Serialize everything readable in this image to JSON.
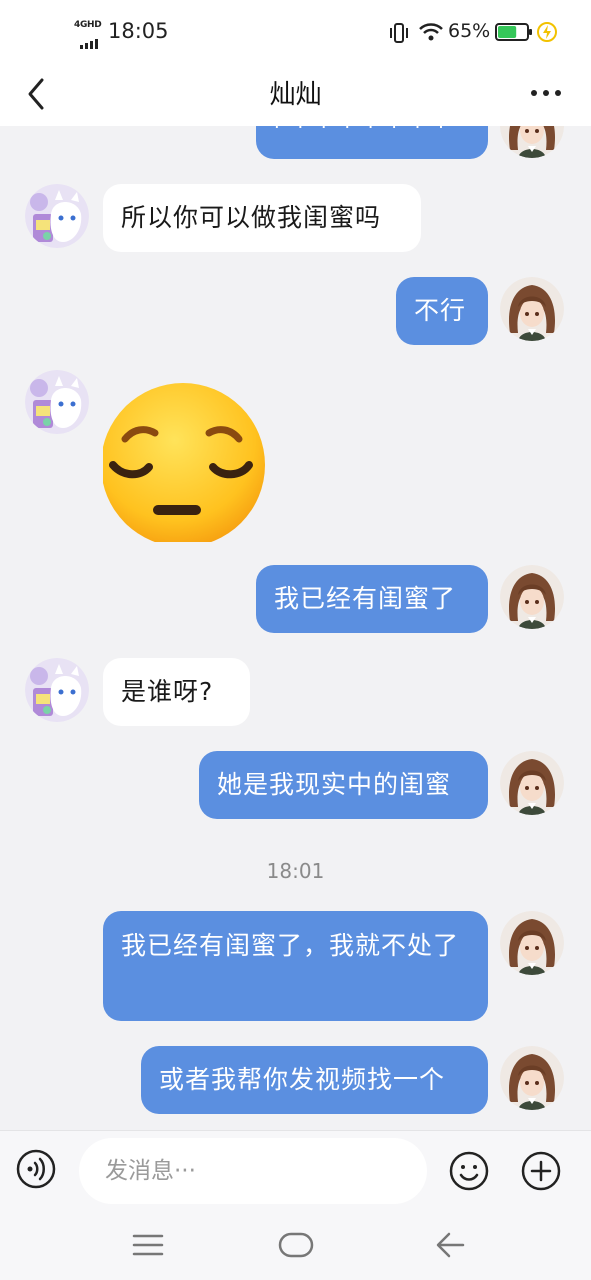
{
  "status_bar": {
    "network": "4GHD",
    "time": "18:05",
    "battery_percent": "65%",
    "battery_level": 0.65,
    "icons": [
      "signal-icon",
      "vibrate-icon",
      "wifi-icon",
      "battery-icon",
      "charging-icon"
    ]
  },
  "header": {
    "title": "灿灿",
    "back_icon": "chevron-left-icon",
    "more_icon": "more-icon"
  },
  "messages": [
    {
      "side": "out",
      "text": "· · · · · · · ·"
    },
    {
      "side": "in",
      "text": "所以你可以做我闺蜜吗"
    },
    {
      "side": "out",
      "text": "不行"
    },
    {
      "side": "in",
      "sticker": "pensive-face-emoji"
    },
    {
      "side": "out",
      "text": "我已经有闺蜜了"
    },
    {
      "side": "in",
      "text": "是谁呀?"
    },
    {
      "side": "out",
      "text": "她是我现实中的闺蜜"
    },
    {
      "timestamp": "18:01"
    },
    {
      "side": "out",
      "text": "我已经有闺蜜了，我就不处了"
    },
    {
      "side": "out",
      "text": "或者我帮你发视频找一个"
    }
  ],
  "input_bar": {
    "placeholder": "发消息···",
    "voice_icon": "voice-icon",
    "emoji_icon": "emoji-icon",
    "plus_icon": "plus-icon"
  },
  "nav_bar": {
    "icons": [
      "menu-icon",
      "home-icon",
      "back-icon"
    ]
  },
  "colors": {
    "outgoing_bubble": "#5b8fe0",
    "incoming_bubble": "#ffffff",
    "chat_background": "#f2f2f4",
    "battery_fill": "#35c759"
  }
}
